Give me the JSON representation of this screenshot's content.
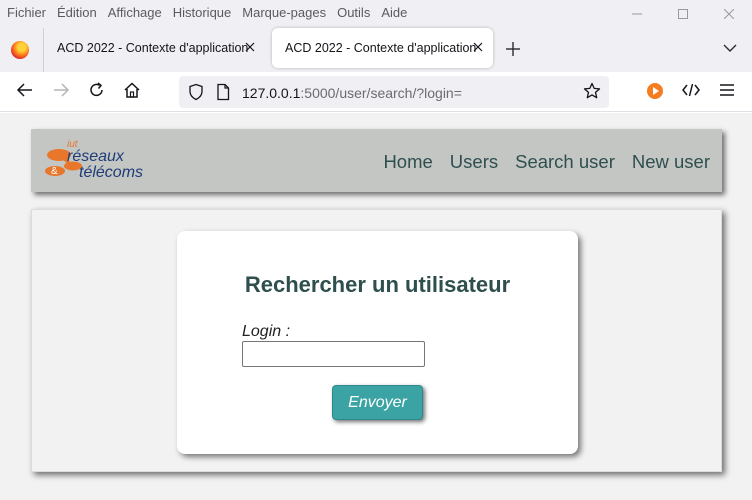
{
  "menu": [
    "Fichier",
    "Édition",
    "Affichage",
    "Historique",
    "Marque-pages",
    "Outils",
    "Aide"
  ],
  "tabs": [
    {
      "title": "ACD 2022 - Contexte d'application",
      "active": false
    },
    {
      "title": "ACD 2022 - Contexte d'application",
      "active": true
    }
  ],
  "url": {
    "host": "127.0.0.1",
    "rest": ":5000/user/search/?login="
  },
  "site": {
    "logo": {
      "top": "iut",
      "line1": "réseaux",
      "line2": "télécoms",
      "amp": "&"
    },
    "nav": [
      "Home",
      "Users",
      "Search user",
      "New user"
    ]
  },
  "form": {
    "title": "Rechercher un utilisateur",
    "login_label": "Login :",
    "login_value": "",
    "submit_label": "Envoyer"
  },
  "colors": {
    "accent": "#3ba3a3",
    "heading": "#2f4f4f",
    "header_bg": "#c3c6c3",
    "logo_orange": "#e8762b",
    "logo_blue": "#1f3c78"
  }
}
